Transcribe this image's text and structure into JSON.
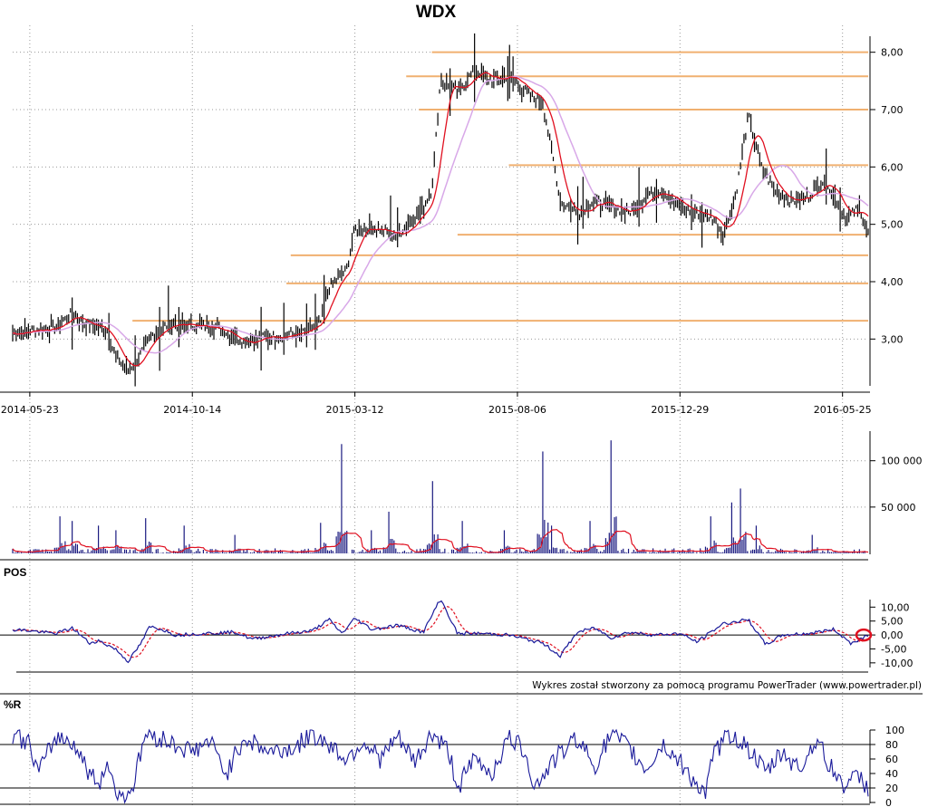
{
  "chart_data": [
    {
      "type": "ohlc",
      "title": "WDX",
      "x_tick_labels": [
        "2014-05-23",
        "2014-10-14",
        "2015-03-12",
        "2015-08-06",
        "2015-12-29",
        "2016-05-25"
      ],
      "y_tick_labels": [
        "3,00",
        "4,00",
        "5,00",
        "6,00",
        "7,00",
        "8,00"
      ],
      "ylim": [
        2.2,
        8.2
      ],
      "grid": true,
      "colors": {
        "bars": "#000000",
        "short_ma": "#e01020",
        "long_ma": "#d8a8e8",
        "levels": "#f0b070"
      },
      "price_path": [
        [
          0,
          3.1
        ],
        [
          0.02,
          3.15
        ],
        [
          0.05,
          3.2
        ],
        [
          0.07,
          3.45
        ],
        [
          0.08,
          3.3
        ],
        [
          0.11,
          3.15
        ],
        [
          0.12,
          2.7
        ],
        [
          0.135,
          2.45
        ],
        [
          0.15,
          2.75
        ],
        [
          0.165,
          3.1
        ],
        [
          0.18,
          3.25
        ],
        [
          0.2,
          3.25
        ],
        [
          0.24,
          3.2
        ],
        [
          0.27,
          2.95
        ],
        [
          0.3,
          3.05
        ],
        [
          0.34,
          3.1
        ],
        [
          0.36,
          3.3
        ],
        [
          0.37,
          3.9
        ],
        [
          0.39,
          4.2
        ],
        [
          0.4,
          4.9
        ],
        [
          0.42,
          4.95
        ],
        [
          0.45,
          4.8
        ],
        [
          0.48,
          5.3
        ],
        [
          0.49,
          5.6
        ],
        [
          0.5,
          7.5
        ],
        [
          0.52,
          7.3
        ],
        [
          0.54,
          7.7
        ],
        [
          0.56,
          7.5
        ],
        [
          0.58,
          7.6
        ],
        [
          0.6,
          7.3
        ],
        [
          0.62,
          7.1
        ],
        [
          0.63,
          6.3
        ],
        [
          0.64,
          5.4
        ],
        [
          0.66,
          5.2
        ],
        [
          0.68,
          5.4
        ],
        [
          0.7,
          5.3
        ],
        [
          0.72,
          5.2
        ],
        [
          0.74,
          5.5
        ],
        [
          0.76,
          5.6
        ],
        [
          0.78,
          5.3
        ],
        [
          0.8,
          5.2
        ],
        [
          0.82,
          5.1
        ],
        [
          0.83,
          4.8
        ],
        [
          0.845,
          5.5
        ],
        [
          0.86,
          6.9
        ],
        [
          0.875,
          6.0
        ],
        [
          0.89,
          5.6
        ],
        [
          0.91,
          5.4
        ],
        [
          0.93,
          5.5
        ],
        [
          0.95,
          5.8
        ],
        [
          0.96,
          5.5
        ],
        [
          0.975,
          5.1
        ],
        [
          0.99,
          5.3
        ],
        [
          1,
          4.85
        ]
      ],
      "horizontal_levels": [
        {
          "value": 8.0,
          "from": 0.49
        },
        {
          "value": 7.58,
          "from": 0.46
        },
        {
          "value": 7.0,
          "from": 0.475
        },
        {
          "value": 6.03,
          "from": 0.58
        },
        {
          "value": 4.82,
          "from": 0.52
        },
        {
          "value": 4.46,
          "from": 0.325
        },
        {
          "value": 3.97,
          "from": 0.32
        },
        {
          "value": 3.32,
          "from": 0.14
        }
      ]
    },
    {
      "type": "bar",
      "y_tick_labels": [
        "50 000",
        "100 000"
      ],
      "ylim": [
        0,
        130000
      ],
      "colors": {
        "bars": "#1a1a80",
        "average": "#e01020"
      },
      "spikes": [
        [
          0.055,
          40000
        ],
        [
          0.07,
          35000
        ],
        [
          0.1,
          30000
        ],
        [
          0.12,
          25000
        ],
        [
          0.155,
          38000
        ],
        [
          0.2,
          30000
        ],
        [
          0.26,
          20000
        ],
        [
          0.36,
          33000
        ],
        [
          0.385,
          118000
        ],
        [
          0.42,
          25000
        ],
        [
          0.44,
          45000
        ],
        [
          0.49,
          78000
        ],
        [
          0.525,
          35000
        ],
        [
          0.575,
          25000
        ],
        [
          0.62,
          110000
        ],
        [
          0.63,
          30000
        ],
        [
          0.675,
          35000
        ],
        [
          0.7,
          122000
        ],
        [
          0.815,
          40000
        ],
        [
          0.84,
          55000
        ],
        [
          0.85,
          70000
        ],
        [
          0.87,
          30000
        ],
        [
          0.935,
          20000
        ]
      ]
    },
    {
      "type": "line",
      "title": "POS",
      "y_tick_labels": [
        "10,00",
        "5,00",
        "0,00",
        "-5,00",
        "-10,00"
      ],
      "ylim": [
        -12,
        14
      ],
      "colors": {
        "line": "#1a1a9a",
        "signal": "#e01020",
        "zero": "#000000",
        "marker": "#e01020"
      },
      "path": [
        [
          0,
          2
        ],
        [
          0.02,
          1.5
        ],
        [
          0.05,
          0.5
        ],
        [
          0.07,
          2.5
        ],
        [
          0.09,
          -3
        ],
        [
          0.1,
          -2
        ],
        [
          0.12,
          -5
        ],
        [
          0.135,
          -9.5
        ],
        [
          0.15,
          -3
        ],
        [
          0.16,
          3
        ],
        [
          0.175,
          2
        ],
        [
          0.19,
          0
        ],
        [
          0.22,
          0.5
        ],
        [
          0.26,
          1
        ],
        [
          0.28,
          -1.5
        ],
        [
          0.32,
          0.5
        ],
        [
          0.35,
          1.5
        ],
        [
          0.37,
          5.5
        ],
        [
          0.385,
          0.5
        ],
        [
          0.4,
          6
        ],
        [
          0.42,
          2
        ],
        [
          0.45,
          3.5
        ],
        [
          0.48,
          1
        ],
        [
          0.5,
          13
        ],
        [
          0.52,
          0.5
        ],
        [
          0.55,
          0.5
        ],
        [
          0.58,
          0
        ],
        [
          0.62,
          -3
        ],
        [
          0.64,
          -7.5
        ],
        [
          0.66,
          1
        ],
        [
          0.68,
          2.5
        ],
        [
          0.7,
          -1
        ],
        [
          0.72,
          1
        ],
        [
          0.75,
          0
        ],
        [
          0.78,
          0.5
        ],
        [
          0.8,
          -2.5
        ],
        [
          0.83,
          4
        ],
        [
          0.86,
          5.5
        ],
        [
          0.88,
          -3.5
        ],
        [
          0.9,
          0
        ],
        [
          0.93,
          0.5
        ],
        [
          0.96,
          2
        ],
        [
          0.98,
          -3
        ],
        [
          1,
          0
        ]
      ]
    },
    {
      "type": "line",
      "title": "%R",
      "y_tick_labels": [
        "100",
        "80",
        "60",
        "40",
        "20",
        "0"
      ],
      "ylim": [
        0,
        100
      ],
      "colors": {
        "line": "#1a1a9a",
        "ref": "#000000"
      },
      "path": [
        [
          0,
          95
        ],
        [
          0.02,
          80
        ],
        [
          0.03,
          40
        ],
        [
          0.05,
          90
        ],
        [
          0.07,
          85
        ],
        [
          0.09,
          40
        ],
        [
          0.1,
          25
        ],
        [
          0.11,
          55
        ],
        [
          0.125,
          5
        ],
        [
          0.14,
          20
        ],
        [
          0.155,
          95
        ],
        [
          0.17,
          90
        ],
        [
          0.19,
          80
        ],
        [
          0.21,
          70
        ],
        [
          0.23,
          85
        ],
        [
          0.25,
          40
        ],
        [
          0.27,
          90
        ],
        [
          0.3,
          70
        ],
        [
          0.33,
          75
        ],
        [
          0.35,
          95
        ],
        [
          0.37,
          80
        ],
        [
          0.39,
          60
        ],
        [
          0.41,
          85
        ],
        [
          0.43,
          60
        ],
        [
          0.45,
          90
        ],
        [
          0.47,
          55
        ],
        [
          0.49,
          95
        ],
        [
          0.51,
          70
        ],
        [
          0.52,
          20
        ],
        [
          0.54,
          60
        ],
        [
          0.56,
          40
        ],
        [
          0.58,
          90
        ],
        [
          0.6,
          70
        ],
        [
          0.61,
          20
        ],
        [
          0.63,
          55
        ],
        [
          0.66,
          90
        ],
        [
          0.68,
          50
        ],
        [
          0.7,
          95
        ],
        [
          0.72,
          75
        ],
        [
          0.74,
          45
        ],
        [
          0.76,
          80
        ],
        [
          0.78,
          55
        ],
        [
          0.8,
          25
        ],
        [
          0.81,
          10
        ],
        [
          0.82,
          70
        ],
        [
          0.84,
          95
        ],
        [
          0.86,
          75
        ],
        [
          0.88,
          40
        ],
        [
          0.9,
          70
        ],
        [
          0.92,
          45
        ],
        [
          0.94,
          90
        ],
        [
          0.95,
          60
        ],
        [
          0.97,
          25
        ],
        [
          0.99,
          35
        ],
        [
          1,
          20
        ]
      ]
    }
  ],
  "credit": "Wykres został stworzony za pomocą programu PowerTrader (www.powertrader.pl)"
}
